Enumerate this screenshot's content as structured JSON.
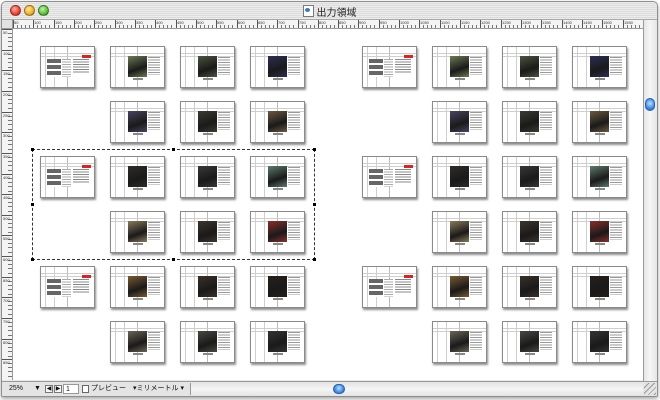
{
  "window": {
    "title": "出力領域"
  },
  "ruler": {
    "horizontal_ticks": [
      "50",
      "100",
      "150",
      "200",
      "250",
      "300",
      "350",
      "400",
      "450",
      "500",
      "550",
      "600",
      "650",
      "700",
      "750",
      "800",
      "850",
      "900",
      "950",
      "1000",
      "1050",
      "1100",
      "1150",
      "1200",
      "1250",
      "1300",
      "1350",
      "1400",
      "1450",
      "1500",
      "1550"
    ],
    "vertical_ticks": [
      "50",
      "100",
      "150",
      "200",
      "250",
      "300",
      "350",
      "400",
      "450",
      "500",
      "550",
      "600",
      "650",
      "700",
      "750",
      "800",
      "850"
    ]
  },
  "canvas": {
    "spreads": [
      {
        "kind": "index",
        "photo": ""
      },
      {
        "kind": "photo",
        "photo": "#6b7a55"
      },
      {
        "kind": "photo",
        "photo": "#4b5440"
      },
      {
        "kind": "photo",
        "photo": "#2a2f55"
      },
      {
        "kind": "photo",
        "photo": "#4a4460"
      },
      {
        "kind": "photo",
        "photo": "#3b3a32"
      },
      {
        "kind": "photo",
        "photo": "#6a5a40"
      },
      {
        "kind": "index",
        "photo": ""
      },
      {
        "kind": "photo",
        "photo": "#2f2c28"
      },
      {
        "kind": "photo",
        "photo": "#3a3836"
      },
      {
        "kind": "photo",
        "photo": "#5e7b6b"
      },
      {
        "kind": "photo",
        "photo": "#8a7a5a"
      },
      {
        "kind": "photo",
        "photo": "#3d352c"
      },
      {
        "kind": "photo",
        "photo": "#8b2e2a"
      },
      {
        "kind": "index",
        "photo": ""
      },
      {
        "kind": "photo",
        "photo": "#7a5a30"
      },
      {
        "kind": "photo",
        "photo": "#3a3028"
      },
      {
        "kind": "photo",
        "photo": "#251f1a"
      },
      {
        "kind": "photo",
        "photo": "#6a6455"
      },
      {
        "kind": "photo",
        "photo": "#4a4742"
      },
      {
        "kind": "photo",
        "photo": "#343434"
      }
    ]
  },
  "statusbar": {
    "zoom": "25%",
    "page_number": "1",
    "view_mode": "プレビュー",
    "unit": "ミリメートル"
  }
}
